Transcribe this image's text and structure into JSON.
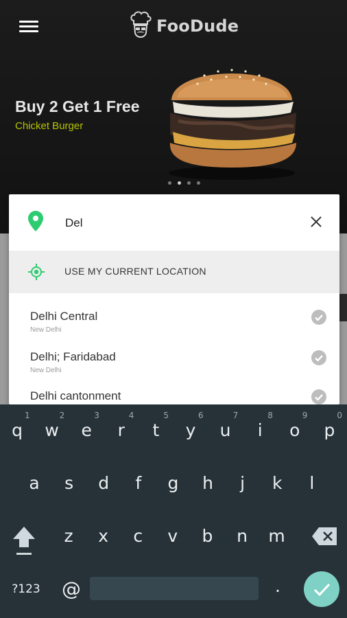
{
  "app": {
    "brand": "FooDude"
  },
  "banner": {
    "title": "Buy 2 Get 1 Free",
    "subtitle": "Chicket Burger",
    "slide_count": 4,
    "active_slide": 2
  },
  "search": {
    "value": "Del",
    "placeholder": ""
  },
  "current_location": {
    "label": "USE MY CURRENT LOCATION"
  },
  "results": [
    {
      "name": "Delhi Central",
      "sub": "New Delhi"
    },
    {
      "name": "Delhi; Faridabad",
      "sub": "New Delhi"
    },
    {
      "name": "Delhi cantonment",
      "sub": ""
    }
  ],
  "keyboard": {
    "row1": [
      "q",
      "w",
      "e",
      "r",
      "t",
      "y",
      "u",
      "i",
      "o",
      "p"
    ],
    "row1_hints": [
      "1",
      "2",
      "3",
      "4",
      "5",
      "6",
      "7",
      "8",
      "9",
      "0"
    ],
    "row2": [
      "a",
      "s",
      "d",
      "f",
      "g",
      "h",
      "j",
      "k",
      "l"
    ],
    "row3": [
      "z",
      "x",
      "c",
      "v",
      "b",
      "n",
      "m"
    ],
    "symbols_label": "?123",
    "at_label": "@",
    "period_label": "."
  },
  "colors": {
    "accent_green": "#2ecc71",
    "subtitle": "#b7c400",
    "enter": "#7fd1c5",
    "keyboard_bg": "#263238"
  },
  "icons": [
    "menu-icon",
    "chef-logo-icon",
    "location-pin-icon",
    "close-icon",
    "gps-target-icon",
    "check-circle-icon",
    "shift-icon",
    "backspace-icon",
    "enter-check-icon"
  ]
}
